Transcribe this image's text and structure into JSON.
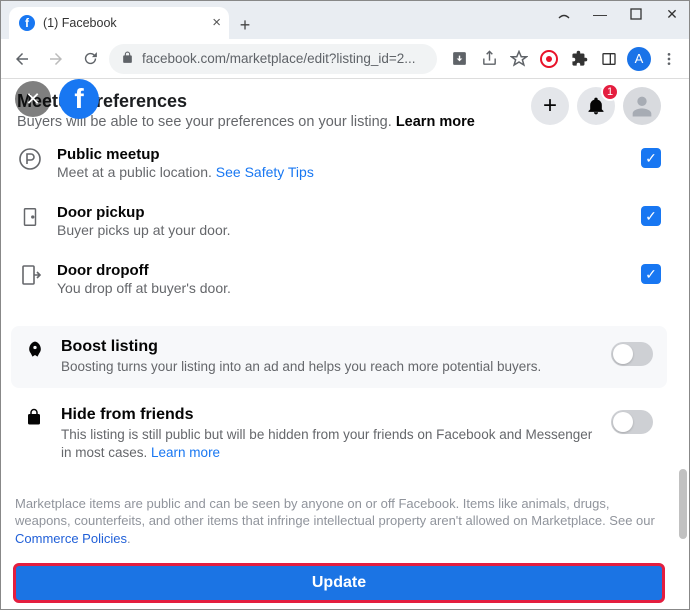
{
  "window": {
    "tab_title": "(1) Facebook",
    "url": "facebook.com/marketplace/edit?listing_id=2...",
    "avatar_letter": "A"
  },
  "fb_header": {
    "notification_count": "1"
  },
  "meetup": {
    "heading": "Meetup preferences",
    "subtext": "Buyers will be able to see your preferences on your listing. ",
    "learn_more": "Learn more",
    "items": [
      {
        "title": "Public meetup",
        "desc_before": "Meet at a public location. ",
        "link": "See Safety Tips",
        "desc_after": "",
        "checked": true
      },
      {
        "title": "Door pickup",
        "desc_before": "Buyer picks up at your door.",
        "link": "",
        "desc_after": "",
        "checked": true
      },
      {
        "title": "Door dropoff",
        "desc_before": "You drop off at buyer's door.",
        "link": "",
        "desc_after": "",
        "checked": true
      }
    ]
  },
  "boost": {
    "title": "Boost listing",
    "desc": "Boosting turns your listing into an ad and helps you reach more potential buyers."
  },
  "hide": {
    "title": "Hide from friends",
    "desc_before": "This listing is still public but will be hidden from your friends on Facebook and Messenger in most cases. ",
    "link": "Learn more"
  },
  "footer": {
    "text_before": "Marketplace items are public and can be seen by anyone on or off Facebook. Items like animals, drugs, weapons, counterfeits, and other items that infringe intellectual property aren't allowed on Marketplace. See our ",
    "link": "Commerce Policies",
    "text_after": "."
  },
  "update_label": "Update"
}
